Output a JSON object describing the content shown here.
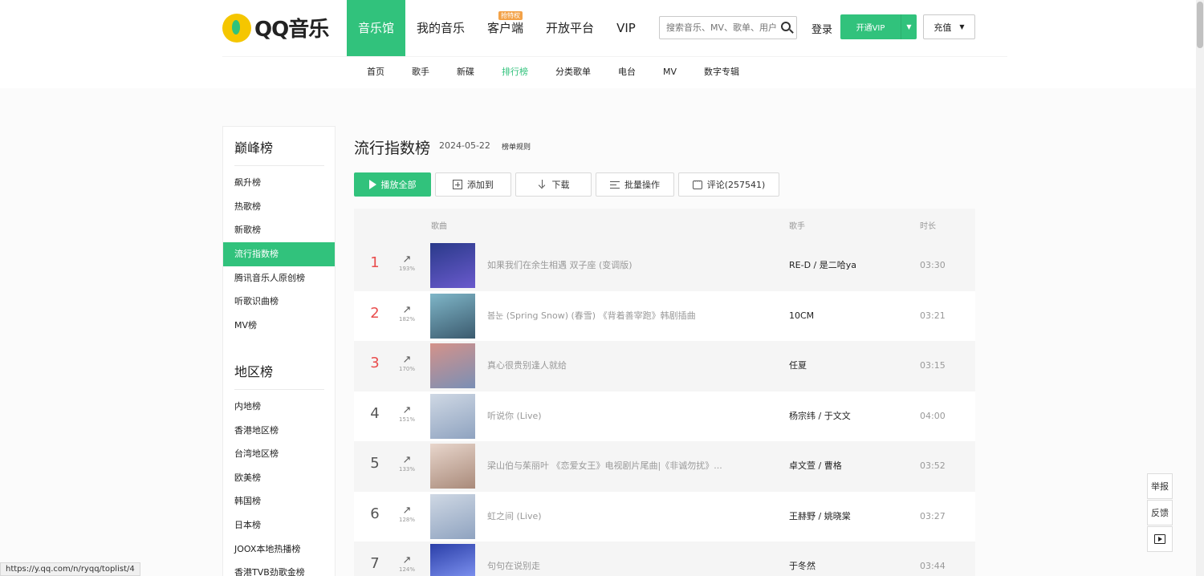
{
  "header": {
    "logo_text": "QQ音乐",
    "nav": [
      {
        "label": "音乐馆",
        "active": true
      },
      {
        "label": "我的音乐"
      },
      {
        "label": "客户端",
        "badge": "抢特权"
      },
      {
        "label": "开放平台"
      },
      {
        "label": "VIP"
      }
    ],
    "search_placeholder": "搜索音乐、MV、歌单、用户",
    "login": "登录",
    "vip_button": "开通VIP",
    "recharge_button": "充值"
  },
  "subnav": [
    "首页",
    "歌手",
    "新碟",
    "排行榜",
    "分类歌单",
    "电台",
    "MV",
    "数字专辑"
  ],
  "subnav_active": "排行榜",
  "sidebar": {
    "section1_title": "巅峰榜",
    "section1_items": [
      "飙升榜",
      "热歌榜",
      "新歌榜",
      "流行指数榜",
      "腾讯音乐人原创榜",
      "听歌识曲榜",
      "MV榜"
    ],
    "section2_title": "地区榜",
    "section2_items": [
      "内地榜",
      "香港地区榜",
      "台湾地区榜",
      "欧美榜",
      "韩国榜",
      "日本榜",
      "JOOX本地热播榜",
      "香港TVB劲歌金榜"
    ],
    "active_item": "流行指数榜"
  },
  "page": {
    "title": "流行指数榜",
    "date": "2024-05-22",
    "rule": "榜单规则"
  },
  "actions": {
    "play_all": "播放全部",
    "add_to": "添加到",
    "download": "下载",
    "batch": "批量操作",
    "comment": "评论(257541)"
  },
  "table": {
    "headers": {
      "song": "歌曲",
      "singer": "歌手",
      "duration": "时长"
    },
    "rows": [
      {
        "rank": "1",
        "pct": "193%",
        "song": "如果我们在余生相遇 双子座 (变调版)",
        "singer": "RE-D / 是二哈ya",
        "duration": "03:30",
        "cover": [
          "#2a3a8a",
          "#6a5acd"
        ]
      },
      {
        "rank": "2",
        "pct": "182%",
        "song": "봄눈 (Spring Snow) (春雪) 《背着善宰跑》韩剧插曲",
        "singer": "10CM",
        "duration": "03:21",
        "cover": [
          "#7fb6c8",
          "#3b5a6e"
        ]
      },
      {
        "rank": "3",
        "pct": "170%",
        "song": "真心很贵别逢人就给",
        "singer": "任夏",
        "duration": "03:15",
        "cover": [
          "#d4928a",
          "#7a8fb5"
        ]
      },
      {
        "rank": "4",
        "pct": "151%",
        "song": "听说你 (Live)",
        "singer": "杨宗纬 / 于文文",
        "duration": "04:00",
        "cover": [
          "#cfd8e4",
          "#8fa3c0"
        ]
      },
      {
        "rank": "5",
        "pct": "133%",
        "song": "梁山伯与茱丽叶 《恋爱女王》电视剧片尾曲|《非诚勿扰》...",
        "singer": "卓文萱 / 曹格",
        "duration": "03:52",
        "cover": [
          "#e8d6cc",
          "#a98a7a"
        ]
      },
      {
        "rank": "6",
        "pct": "128%",
        "song": "虹之间 (Live)",
        "singer": "王赫野 / 姚晓棠",
        "duration": "03:27",
        "cover": [
          "#cfd8e4",
          "#8fa3c0"
        ]
      },
      {
        "rank": "7",
        "pct": "124%",
        "song": "句句在说别走",
        "singer": "于冬然",
        "duration": "03:44",
        "cover": [
          "#2b3fa8",
          "#8fa3ff"
        ]
      }
    ]
  },
  "float_tools": {
    "report": "举报",
    "feedback": "反馈"
  },
  "status_url": "https://y.qq.com/n/ryqq/toplist/4",
  "colors": {
    "accent": "#31c27c",
    "top_rank": "#e94d4d"
  }
}
